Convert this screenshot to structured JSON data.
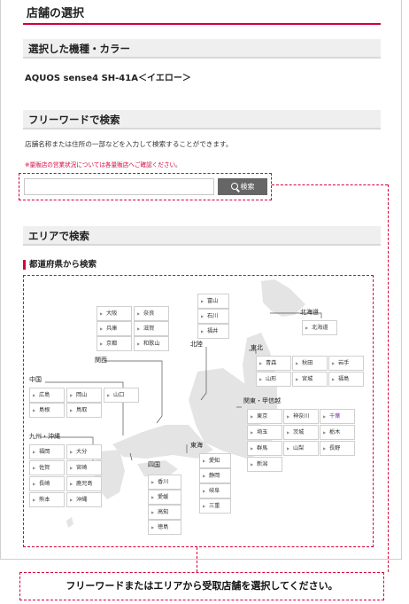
{
  "page_title": "店舗の選択",
  "selected_section": {
    "heading": "選択した機種・カラー",
    "model": "AQUOS sense4 SH-41A＜イエロー＞"
  },
  "free_word": {
    "heading": "フリーワードで検索",
    "description": "店舗名称または住所の一部などを入力して検索することができます。",
    "note": "※量販店の営業状況については各量販店へご確認ください。",
    "input_value": "",
    "button_label": "検索"
  },
  "area": {
    "heading": "エリアで検索",
    "pref_heading": "都道府県から検索",
    "regions": {
      "hokkaido": {
        "label": "北海道",
        "prefs": [
          "北海道"
        ]
      },
      "tohoku": {
        "label": "東北",
        "prefs": [
          "青森",
          "秋田",
          "岩手",
          "山形",
          "宮城",
          "福島"
        ]
      },
      "kanto": {
        "label": "関東・甲信越",
        "prefs": [
          "東京",
          "神奈川",
          "千葉",
          "埼玉",
          "茨城",
          "栃木",
          "群馬",
          "山梨",
          "長野",
          "新潟"
        ]
      },
      "hokuriku": {
        "label": "北陸",
        "prefs": [
          "富山",
          "石川",
          "福井"
        ]
      },
      "tokai": {
        "label": "東海",
        "prefs": [
          "愛知",
          "静岡",
          "岐阜",
          "三重"
        ]
      },
      "kansai": {
        "label": "関西",
        "prefs": [
          "大阪",
          "奈良",
          "兵庫",
          "滋賀",
          "京都",
          "和歌山"
        ]
      },
      "chugoku": {
        "label": "中国",
        "prefs": [
          "広島",
          "岡山",
          "山口",
          "島根",
          "鳥取"
        ]
      },
      "shikoku": {
        "label": "四国",
        "prefs": [
          "香川",
          "愛媛",
          "高知",
          "徳島"
        ]
      },
      "kyushu": {
        "label": "九州・沖縄",
        "prefs": [
          "福岡",
          "大分",
          "佐賀",
          "宮崎",
          "長崎",
          "鹿児島",
          "熊本",
          "沖縄"
        ]
      }
    },
    "highlight_pref": "千葉"
  },
  "callout_text": "フリーワードまたはエリアから受取店舗を選択してください。",
  "colors": {
    "accent": "#d7003a",
    "map": "#e4e4e4",
    "highlight": "#7a2fa5"
  }
}
